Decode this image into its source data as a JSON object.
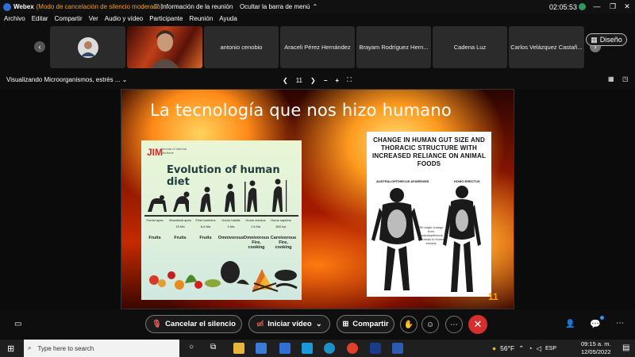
{
  "titlebar": {
    "app_name": "Webex",
    "mode": "(Modo de cancelación de silencio moderado)",
    "meeting_info": "Información de la reunión",
    "hide_menu": "Ocultar la barra de menú",
    "time": "02:05:53",
    "user_initial": "J"
  },
  "menu": [
    "Archivo",
    "Editar",
    "Compartir",
    "Ver",
    "Audio y vídeo",
    "Participante",
    "Reunión",
    "Ayuda"
  ],
  "participants": [
    {
      "name": ""
    },
    {
      "name": ""
    },
    {
      "name": "antonio cenobio"
    },
    {
      "name": "Araceli Pérez Hernández"
    },
    {
      "name": "Brayam Rodríguez Hern..."
    },
    {
      "name": "Cadena Luz"
    },
    {
      "name": "Carlos Velázquez Castañ..."
    }
  ],
  "layout_button": "Diseño",
  "share_bar": {
    "title": "Visualizando Microorganismos, estrés ...",
    "page": "11"
  },
  "slide": {
    "title": "La tecnología que nos hizo humano",
    "number": "11",
    "left_card": {
      "journal": "JIM",
      "journal_sub": "Journal of Internal Medicine",
      "heading": "Evolution of human diet",
      "species": [
        "Forest apes",
        "Woodland apes",
        "First hominins",
        "Homo habilis",
        "Homo erectus",
        "Homo sapiens"
      ],
      "ages": [
        "",
        "15 Ma",
        "8-6 Ma",
        "3 Ma",
        "1.8 Ma",
        "800 kyr"
      ],
      "diets": [
        "Fruits",
        "Fruits",
        "Fruits",
        "Omnivorous",
        "Omnivorous Fire, cooking",
        "Carnivorous Fire, cooking"
      ]
    },
    "right_card": {
      "heading": "CHANGE IN HUMAN GUT SIZE AND THORACIC STRUCTURE WITH INCREASED RELIANCE ON ANIMAL FOODS",
      "left_label": "AUSTRALOPITHECUS AFARENSIS",
      "right_label": "HOMO ERECTUS",
      "note": "Rib angle change from Australopithecus afarensis to Homo erectus"
    }
  },
  "controls": {
    "mute": "Cancelar el silencio",
    "video": "Iniciar vídeo",
    "share": "Compartir"
  },
  "taskbar": {
    "search_placeholder": "Type here to search",
    "weather": "56°F",
    "lang": "ESP",
    "time": "09:15 a. m.",
    "date": "12/05/2022"
  },
  "colors": {
    "accent_blue": "#2f6fd6",
    "leave_red": "#d62d2d",
    "moderated_orange": "#f0a030"
  }
}
